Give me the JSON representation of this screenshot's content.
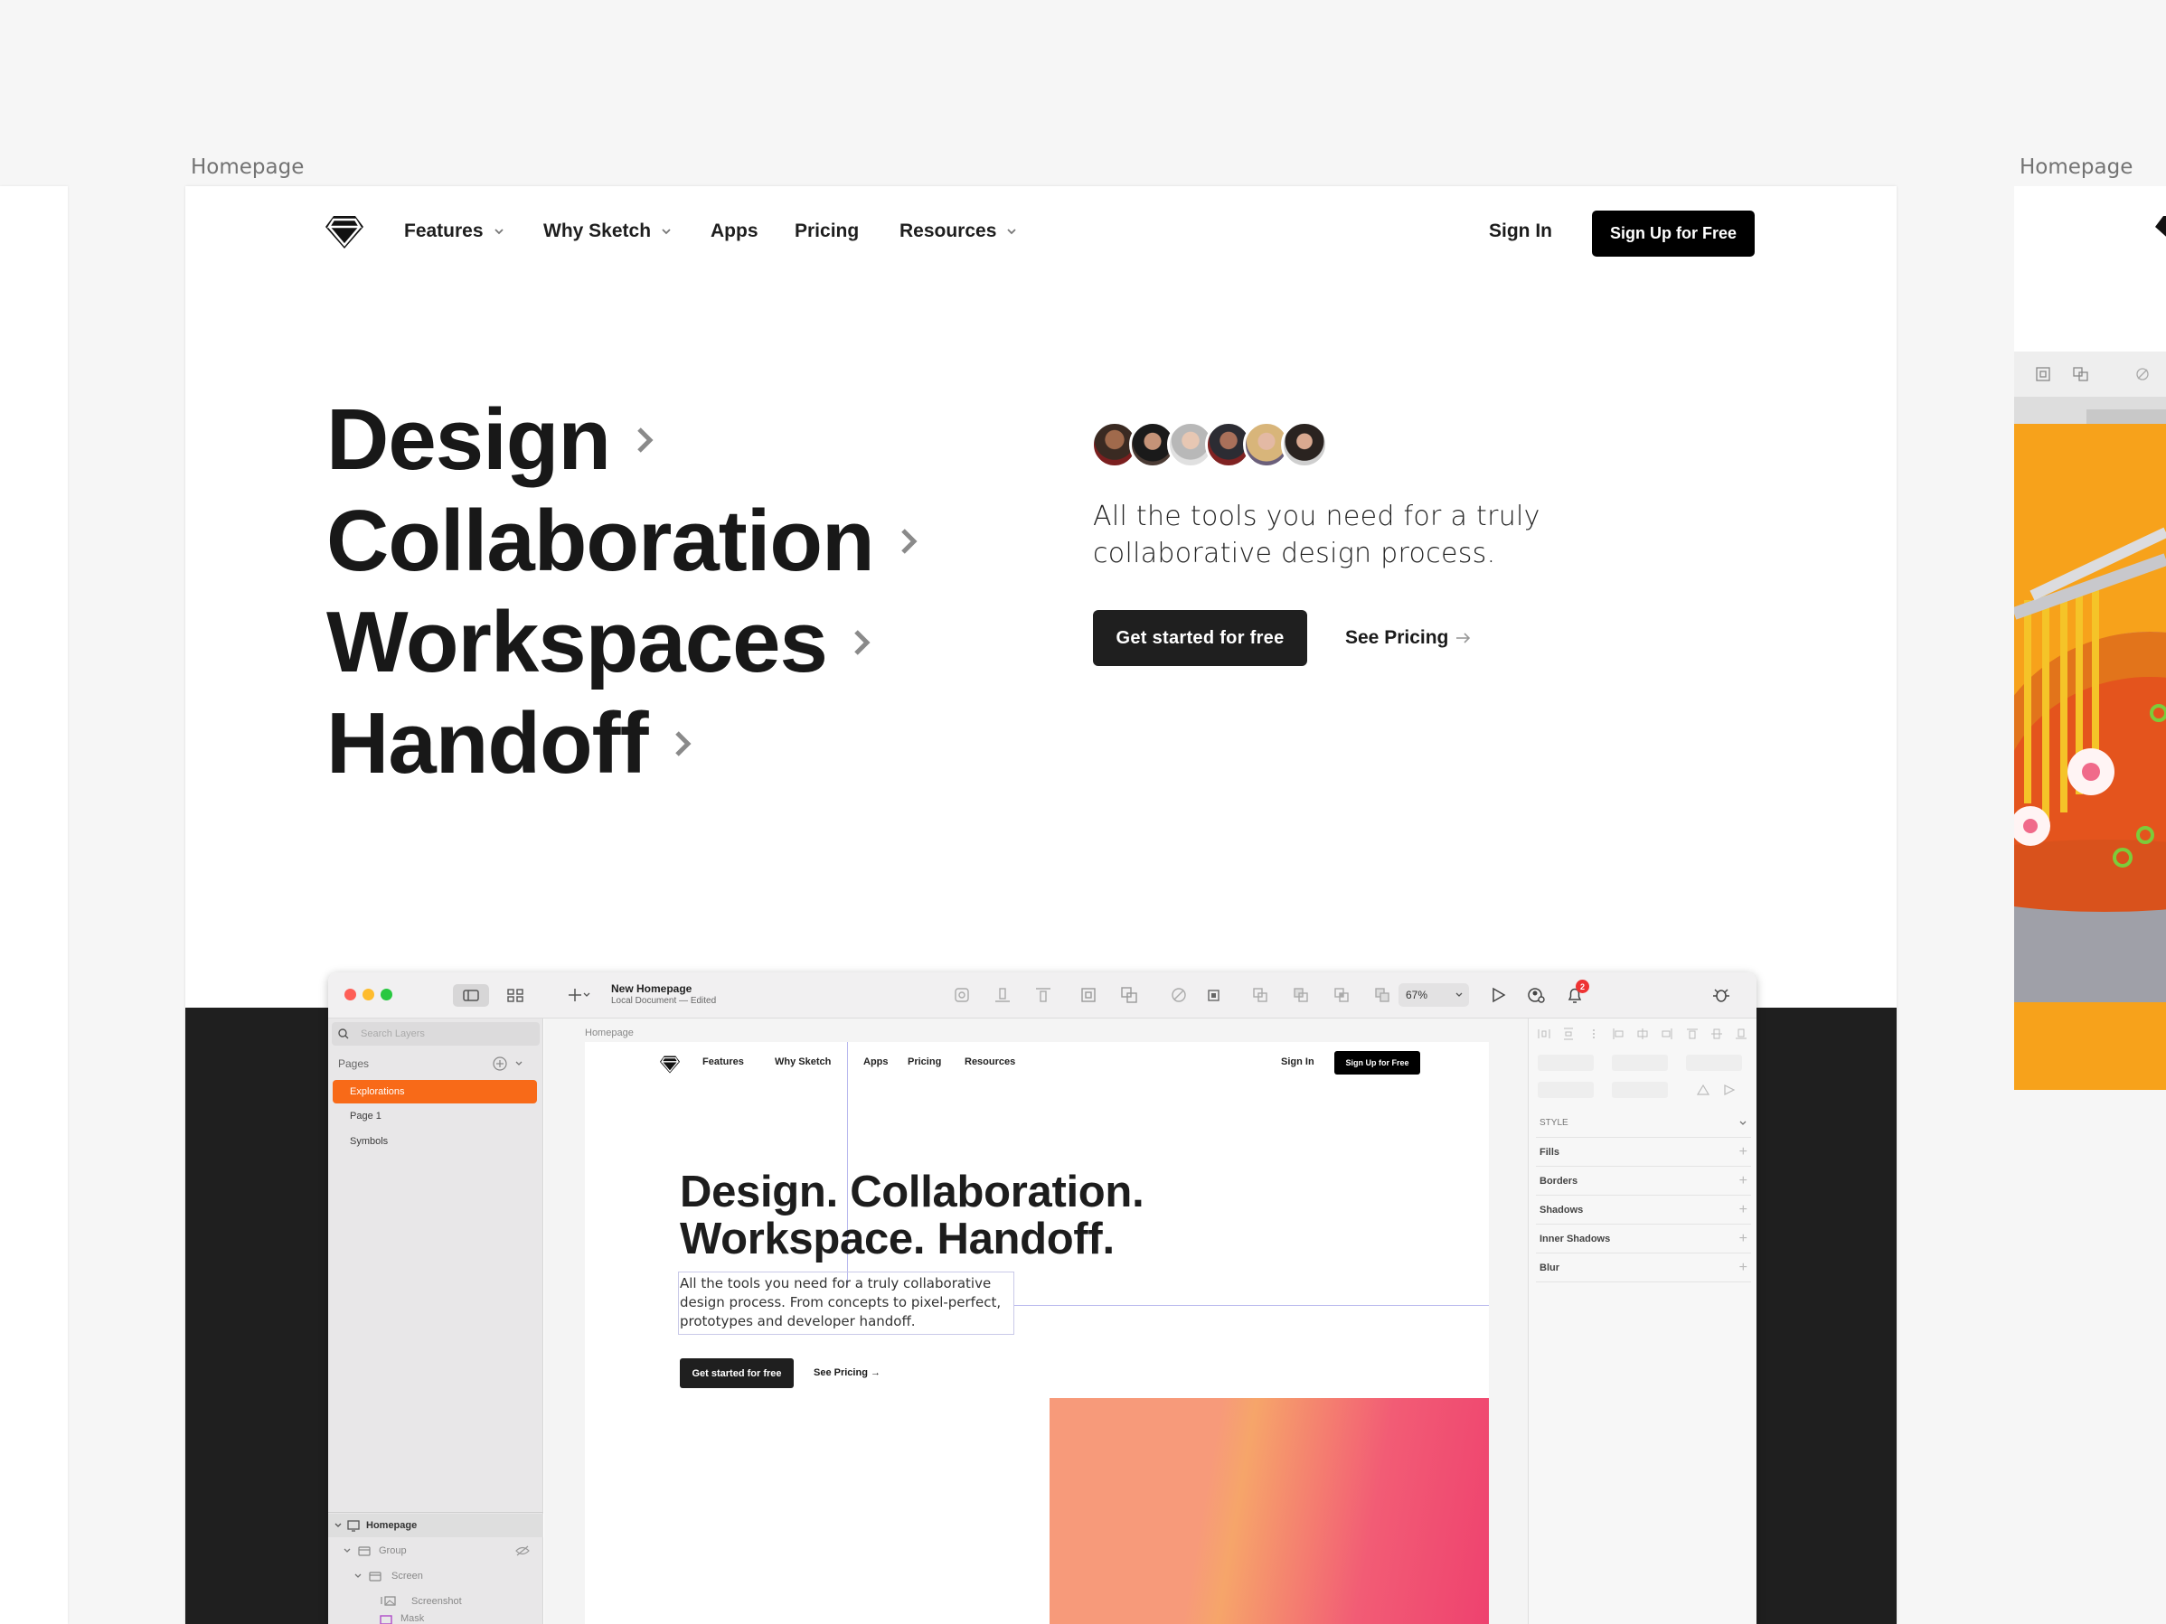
{
  "artboards": {
    "left_label": "Homepage",
    "right_label": "Homepage"
  },
  "nav": {
    "items": [
      "Features",
      "Why Sketch",
      "Apps",
      "Pricing",
      "Resources"
    ],
    "sign_in": "Sign In",
    "sign_up": "Sign Up for Free"
  },
  "hero": {
    "lines": [
      "Design",
      "Collaboration",
      "Workspaces",
      "Handoff"
    ],
    "tagline": "All the tools you need for a truly collaborative design process.",
    "cta": "Get started for free",
    "see_pricing": "See Pricing"
  },
  "colors": {
    "accent": "#f86a18",
    "dark_band": "#1f1f1f",
    "cta_bg": "#1f1f1f"
  },
  "app": {
    "doc_title": "New Homepage",
    "doc_subtitle": "Local Document — Edited",
    "zoom": "67%",
    "notifications": "2",
    "search_placeholder": "Search Layers",
    "pages_label": "Pages",
    "pages": [
      "Explorations",
      "Page 1",
      "Symbols"
    ],
    "layers": [
      "Homepage",
      "Group",
      "Screen",
      "Screenshot",
      "Mask"
    ],
    "canvas_artboard_label": "Homepage",
    "inspector": {
      "style_label": "STYLE",
      "rows": [
        "Fills",
        "Borders",
        "Shadows",
        "Inner Shadows",
        "Blur"
      ]
    },
    "mini_site": {
      "nav": [
        "Features",
        "Why Sketch",
        "Apps",
        "Pricing",
        "Resources"
      ],
      "sign_in": "Sign In",
      "sign_up": "Sign Up for Free",
      "headline_1": "Design. Collaboration.",
      "headline_2": "Workspace. Handoff.",
      "paragraph": "All the tools you need for a truly collaborative design process. From concepts to pixel-perfect, prototypes and developer handoff.",
      "cta": "Get started for free",
      "see_pricing": "See Pricing →"
    }
  }
}
